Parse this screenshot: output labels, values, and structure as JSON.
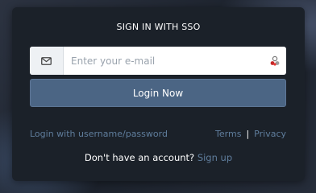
{
  "title": "SIGN IN WITH SSO",
  "email": {
    "placeholder": "Enter your e-mail",
    "value": "",
    "addon_icon": "envelope-icon",
    "extension_icon": "password-manager-icon"
  },
  "login_button": "Login Now",
  "links": {
    "alt_login": "Login with username/password",
    "terms": "Terms",
    "separator": "|",
    "privacy": "Privacy"
  },
  "signup": {
    "prompt": "Don't have an account?",
    "link": "Sign up"
  },
  "colors": {
    "card": "#1b2129",
    "button": "#4b6584",
    "link": "#5f7d9c",
    "text": "#ffffff"
  }
}
